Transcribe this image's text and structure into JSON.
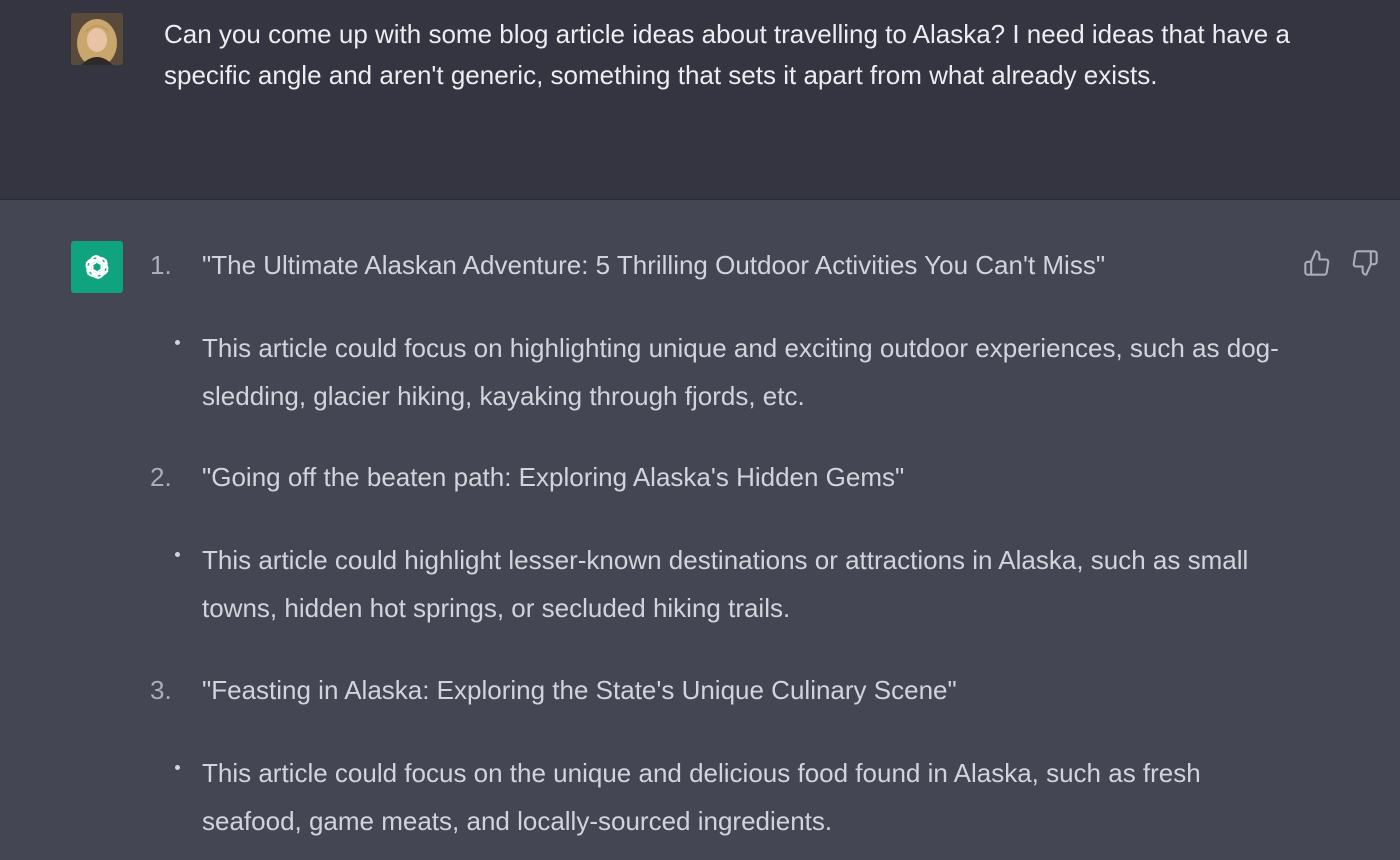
{
  "user_message": {
    "text": "Can you come up with some blog article ideas about travelling to Alaska? I need ideas that have a specific angle and aren't generic, something that sets it apart from what already exists."
  },
  "assistant_message": {
    "items": [
      {
        "number": "1.",
        "title": "\"The Ultimate Alaskan Adventure: 5 Thrilling Outdoor Activities You Can't Miss\"",
        "bullet": "This article could focus on highlighting unique and exciting outdoor experiences, such as dog-sledding, glacier hiking, kayaking through fjords, etc."
      },
      {
        "number": "2.",
        "title": "\"Going off the beaten path: Exploring Alaska's Hidden Gems\"",
        "bullet": "This article could highlight lesser-known destinations or attractions in Alaska, such as small towns, hidden hot springs, or secluded hiking trails."
      },
      {
        "number": "3.",
        "title": "\"Feasting in Alaska: Exploring the State's Unique Culinary Scene\"",
        "bullet": "This article could focus on the unique and delicious food found in Alaska, such as fresh seafood, game meats, and locally-sourced ingredients."
      }
    ]
  },
  "icons": {
    "avatar": "user-avatar",
    "assistant": "openai-logo-icon",
    "thumbs_up": "thumbs-up-icon",
    "thumbs_down": "thumbs-down-icon"
  },
  "colors": {
    "user_bg": "#343541",
    "assistant_bg": "#444654",
    "logo_bg": "#10a37f"
  }
}
